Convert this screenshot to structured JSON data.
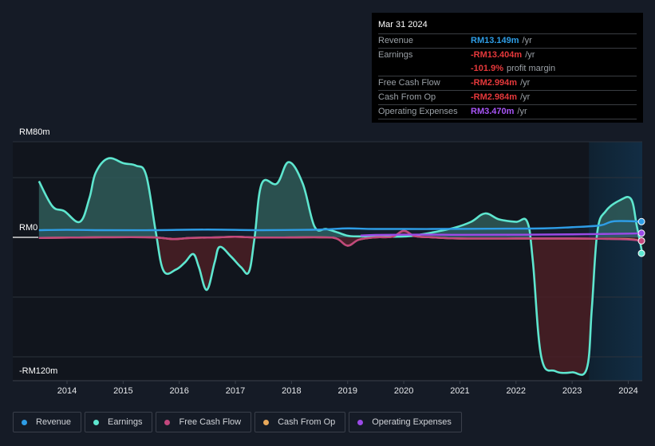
{
  "tooltip": {
    "date": "Mar 31 2024",
    "rows": [
      {
        "label": "Revenue",
        "value": "RM13.149m",
        "unit": "/yr",
        "color": "#2e9de6"
      },
      {
        "label": "Earnings",
        "value": "-RM13.404m",
        "unit": "/yr",
        "color": "#e5383b"
      },
      {
        "label": "",
        "value": "-101.9%",
        "unit": "profit margin",
        "color": "#e5383b"
      },
      {
        "label": "Free Cash Flow",
        "value": "-RM2.994m",
        "unit": "/yr",
        "color": "#e5383b"
      },
      {
        "label": "Cash From Op",
        "value": "-RM2.984m",
        "unit": "/yr",
        "color": "#e5383b"
      },
      {
        "label": "Operating Expenses",
        "value": "RM3.470m",
        "unit": "/yr",
        "color": "#a855f7"
      }
    ]
  },
  "legend": [
    {
      "label": "Revenue",
      "color": "#2e9de6"
    },
    {
      "label": "Earnings",
      "color": "#5ee6cf"
    },
    {
      "label": "Free Cash Flow",
      "color": "#c2477d"
    },
    {
      "label": "Cash From Op",
      "color": "#e8a85a"
    },
    {
      "label": "Operating Expenses",
      "color": "#9b4ae8"
    }
  ],
  "chart_data": {
    "type": "area",
    "title": "",
    "xlabel": "",
    "ylabel": "",
    "y_tick_labels": [
      "RM80m",
      "RM0",
      "-RM120m"
    ],
    "ylim": [
      -120,
      80
    ],
    "gridlines": [
      80,
      50,
      0,
      -50,
      -100
    ],
    "xlim": [
      2013.5,
      2024.25
    ],
    "x_tick_labels": [
      "2014",
      "2015",
      "2016",
      "2017",
      "2018",
      "2019",
      "2020",
      "2021",
      "2022",
      "2023",
      "2024"
    ],
    "x_ticks": [
      2014,
      2015,
      2016,
      2017,
      2018,
      2019,
      2020,
      2021,
      2022,
      2023,
      2024
    ],
    "highlight_from": 2023.3,
    "grid": true,
    "legend_position": "bottom",
    "series": [
      {
        "name": "Revenue",
        "color": "#2e9de6",
        "points": [
          [
            2013.5,
            6
          ],
          [
            2014.0,
            6.3
          ],
          [
            2014.5,
            6
          ],
          [
            2015.5,
            6
          ],
          [
            2016.5,
            6.5
          ],
          [
            2017.5,
            6
          ],
          [
            2018.5,
            6.5
          ],
          [
            2019.0,
            7.5
          ],
          [
            2019.5,
            7
          ],
          [
            2020.5,
            7
          ],
          [
            2021.5,
            7.2
          ],
          [
            2022.5,
            7.5
          ],
          [
            2023.0,
            8.5
          ],
          [
            2023.5,
            10
          ],
          [
            2023.75,
            13.5
          ],
          [
            2024.25,
            13.149
          ]
        ]
      },
      {
        "name": "Earnings",
        "color": "#5ee6cf",
        "points": [
          [
            2013.5,
            47
          ],
          [
            2013.74,
            26
          ],
          [
            2013.95,
            22
          ],
          [
            2014.23,
            13
          ],
          [
            2014.4,
            33
          ],
          [
            2014.51,
            54
          ],
          [
            2014.73,
            66
          ],
          [
            2015.01,
            62
          ],
          [
            2015.23,
            60
          ],
          [
            2015.41,
            52
          ],
          [
            2015.58,
            5
          ],
          [
            2015.72,
            -28
          ],
          [
            2015.94,
            -27
          ],
          [
            2016.1,
            -21
          ],
          [
            2016.25,
            -14
          ],
          [
            2016.35,
            -25
          ],
          [
            2016.49,
            -44
          ],
          [
            2016.63,
            -21
          ],
          [
            2016.72,
            -8
          ],
          [
            2016.92,
            -16
          ],
          [
            2017.1,
            -25
          ],
          [
            2017.24,
            -29
          ],
          [
            2017.34,
            -1
          ],
          [
            2017.47,
            45
          ],
          [
            2017.74,
            45
          ],
          [
            2017.95,
            63
          ],
          [
            2018.2,
            45
          ],
          [
            2018.41,
            9
          ],
          [
            2018.62,
            7
          ],
          [
            2018.83,
            4
          ],
          [
            2019.05,
            1
          ],
          [
            2019.5,
            1
          ],
          [
            2019.8,
            0.5
          ],
          [
            2020.1,
            1
          ],
          [
            2020.5,
            4
          ],
          [
            2020.9,
            8
          ],
          [
            2021.2,
            13
          ],
          [
            2021.45,
            20
          ],
          [
            2021.7,
            15
          ],
          [
            2022.0,
            13
          ],
          [
            2022.2,
            13
          ],
          [
            2022.3,
            -20
          ],
          [
            2022.45,
            -100
          ],
          [
            2022.7,
            -112
          ],
          [
            2023.0,
            -113
          ],
          [
            2023.26,
            -110
          ],
          [
            2023.35,
            -60
          ],
          [
            2023.45,
            5
          ],
          [
            2023.6,
            22
          ],
          [
            2023.85,
            31
          ],
          [
            2024.05,
            32
          ],
          [
            2024.15,
            10
          ],
          [
            2024.25,
            -13.404
          ]
        ]
      },
      {
        "name": "Free Cash Flow",
        "color": "#c2477d",
        "points": [
          [
            2013.5,
            -0.5
          ],
          [
            2014.5,
            0
          ],
          [
            2015.5,
            0
          ],
          [
            2015.9,
            -1.5
          ],
          [
            2016.2,
            -0.5
          ],
          [
            2016.7,
            0
          ],
          [
            2017.0,
            0.5
          ],
          [
            2017.5,
            -0.2
          ],
          [
            2018.5,
            0
          ],
          [
            2018.8,
            -1
          ],
          [
            2019.0,
            -7
          ],
          [
            2019.2,
            -2
          ],
          [
            2019.5,
            0
          ],
          [
            2019.8,
            0.5
          ],
          [
            2020.0,
            5.5
          ],
          [
            2020.2,
            1
          ],
          [
            2020.5,
            0
          ],
          [
            2021.0,
            -1
          ],
          [
            2022.0,
            -1
          ],
          [
            2023.0,
            -1
          ],
          [
            2023.5,
            -1.2
          ],
          [
            2024.0,
            -1.8
          ],
          [
            2024.25,
            -2.994
          ]
        ]
      },
      {
        "name": "Cash From Op",
        "color": "#e8a85a",
        "points": [
          [
            2013.5,
            -0.5
          ],
          [
            2014.5,
            0
          ],
          [
            2015.5,
            0
          ],
          [
            2015.9,
            -1.5
          ],
          [
            2016.2,
            -0.5
          ],
          [
            2016.7,
            0
          ],
          [
            2017.0,
            0.5
          ],
          [
            2017.5,
            -0.2
          ],
          [
            2018.5,
            0
          ],
          [
            2018.8,
            -1
          ],
          [
            2019.0,
            -7
          ],
          [
            2019.2,
            -2
          ],
          [
            2019.5,
            0
          ],
          [
            2019.8,
            0.5
          ],
          [
            2020.0,
            5.5
          ],
          [
            2020.2,
            1
          ],
          [
            2020.5,
            0
          ],
          [
            2021.0,
            -1
          ],
          [
            2022.0,
            -1
          ],
          [
            2023.0,
            -1
          ],
          [
            2023.5,
            -1.2
          ],
          [
            2024.0,
            -1.5
          ],
          [
            2024.25,
            -2.984
          ]
        ]
      },
      {
        "name": "Operating Expenses",
        "color": "#9b4ae8",
        "points": [
          [
            2019.23,
            1.5
          ],
          [
            2019.5,
            2
          ],
          [
            2020.0,
            2.2
          ],
          [
            2020.5,
            2.3
          ],
          [
            2021.0,
            2.1
          ],
          [
            2022.0,
            2.2
          ],
          [
            2023.0,
            2.5
          ],
          [
            2023.5,
            2.8
          ],
          [
            2024.0,
            3.1
          ],
          [
            2024.25,
            3.47
          ]
        ]
      }
    ]
  }
}
